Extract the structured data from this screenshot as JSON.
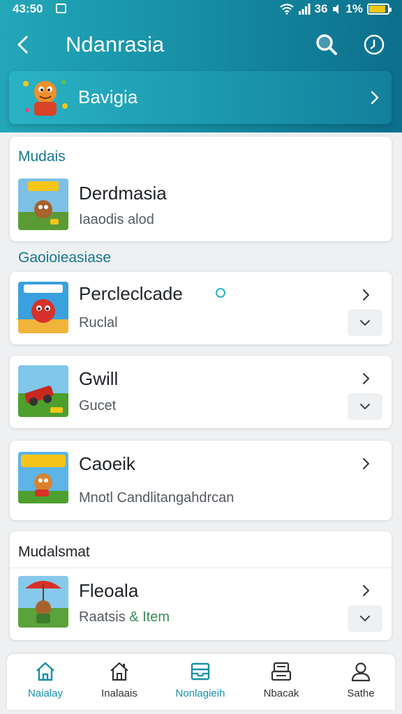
{
  "status": {
    "time": "43:50",
    "network": "36",
    "battery": "1%",
    "battery_level": 0.9
  },
  "appbar": {
    "title": "Ndanrasia",
    "icons": [
      "back-icon",
      "search-icon",
      "info-icon"
    ]
  },
  "banner": {
    "label": "Bavigia"
  },
  "sections": [
    {
      "title": "Mudais",
      "items": [
        {
          "title": "Derdmasia",
          "subtitle": "Iaaodis alod"
        }
      ]
    },
    {
      "title": "Gaoioieasiase",
      "items": [
        {
          "title": "Percleclcade",
          "subtitle": "Ruclal"
        },
        {
          "title": "Gwill",
          "subtitle": "Gucet"
        },
        {
          "title": "Caoeik",
          "subtitle": "Mnotl Candlitangahdrcan"
        }
      ]
    },
    {
      "title": "Mudalsmat",
      "items": [
        {
          "title": "Fleoala",
          "subtitle_prefix": "Raatsis",
          "subtitle_accent": "& Item"
        }
      ]
    }
  ],
  "bottom_nav": [
    {
      "label": "Naialay",
      "icon": "home-icon",
      "active": true
    },
    {
      "label": "Inalaais",
      "icon": "house-icon",
      "active": false
    },
    {
      "label": "Nonlagieih",
      "icon": "inbox-icon",
      "active": true
    },
    {
      "label": "Nbacak",
      "icon": "tray-icon",
      "active": false
    },
    {
      "label": "Sathe",
      "icon": "profile-icon",
      "active": false
    }
  ],
  "colors": {
    "accent": "#1790a6",
    "header_start": "#23a7b8",
    "header_end": "#0c6f8c",
    "section_title": "#15788c",
    "accent_green": "#3a8a5c"
  }
}
